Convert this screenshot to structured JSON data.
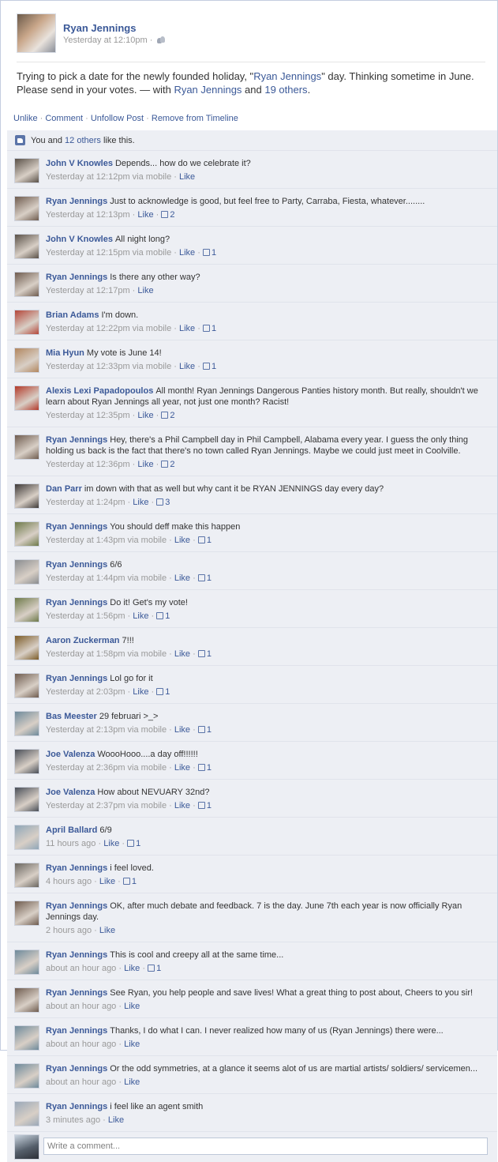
{
  "post": {
    "author": "Ryan Jennings",
    "time": "Yesterday at 12:10pm",
    "sep": "·",
    "text_part1": "Trying to pick a date for the newly founded holiday, \"",
    "text_link": "Ryan Jennings",
    "text_part2": "\" day. Thinking sometime in June. Please send in your votes. — with ",
    "with_name": "Ryan Jennings",
    "with_and": " and ",
    "with_others": "19 others",
    "with_end": "."
  },
  "actions": {
    "unlike": "Unlike",
    "comment": "Comment",
    "unfollow": "Unfollow Post",
    "remove": "Remove from Timeline",
    "sep": " · "
  },
  "likes": {
    "prefix": "You and ",
    "others": "12 others",
    "suffix": " like this."
  },
  "avatars": {
    "john": "#5a5148",
    "ryan": "#6f5c4f",
    "brian": "#b4473a",
    "mia": "#b2875f",
    "alexis": "#b33a2a",
    "dan": "#3e3a38",
    "outdoor": "#6e7a4a",
    "cap": "#8a8d90",
    "aaron": "#7c5c28",
    "bas": "#6e8a9b",
    "joe": "#4a4f58",
    "april": "#8fa6b8",
    "gym": "#6a6660",
    "agent": "#9aa8b8"
  },
  "comments": [
    {
      "name": "John V Knowles",
      "text": "Depends... how do we celebrate it?",
      "time": "Yesterday at 12:12pm",
      "via": " via mobile",
      "like": "Like",
      "count": "",
      "avatar": "john"
    },
    {
      "name": "Ryan Jennings",
      "text": "Just to acknowledge is good, but feel free to Party, Carraba, Fiesta, whatever........",
      "time": "Yesterday at 12:13pm",
      "via": "",
      "like": "Like",
      "count": "2",
      "avatar": "ryan"
    },
    {
      "name": "John V Knowles",
      "text": "All night long?",
      "time": "Yesterday at 12:15pm",
      "via": " via mobile",
      "like": "Like",
      "count": "1",
      "avatar": "john"
    },
    {
      "name": "Ryan Jennings",
      "text": "Is there any other way?",
      "time": "Yesterday at 12:17pm",
      "via": "",
      "like": "Like",
      "count": "",
      "avatar": "ryan"
    },
    {
      "name": "Brian Adams",
      "text": "I'm down.",
      "time": "Yesterday at 12:22pm",
      "via": " via mobile",
      "like": "Like",
      "count": "1",
      "avatar": "brian"
    },
    {
      "name": "Mia Hyun",
      "text": "My vote is June 14!",
      "time": "Yesterday at 12:33pm",
      "via": " via mobile",
      "like": "Like",
      "count": "1",
      "avatar": "mia"
    },
    {
      "name": "Alexis Lexi Papadopoulos",
      "text": "All month! Ryan Jennings Dangerous Panties history month. But really, shouldn't we learn about Ryan Jennings all year, not just one month? Racist!",
      "time": "Yesterday at 12:35pm",
      "via": "",
      "like": "Like",
      "count": "2",
      "avatar": "alexis"
    },
    {
      "name": "Ryan Jennings",
      "text": "Hey, there's a Phil Campbell day in Phil Campbell, Alabama every year. I guess the only thing holding us back is the fact that there's no town called Ryan Jennings. Maybe we could just meet in Coolville.",
      "time": "Yesterday at 12:36pm",
      "via": "",
      "like": "Like",
      "count": "2",
      "avatar": "ryan"
    },
    {
      "name": "Dan Parr",
      "text": "im down with that as well but why cant it be RYAN JENNINGS day every day?",
      "time": "Yesterday at 1:24pm",
      "via": "",
      "like": "Like",
      "count": "3",
      "avatar": "dan"
    },
    {
      "name": "Ryan Jennings",
      "text": "You should deff make this happen",
      "time": "Yesterday at 1:43pm",
      "via": " via mobile",
      "like": "Like",
      "count": "1",
      "avatar": "outdoor"
    },
    {
      "name": "Ryan Jennings",
      "text": "6/6",
      "time": "Yesterday at 1:44pm",
      "via": " via mobile",
      "like": "Like",
      "count": "1",
      "avatar": "cap"
    },
    {
      "name": "Ryan Jennings",
      "text": "Do it! Get's my vote!",
      "time": "Yesterday at 1:56pm",
      "via": "",
      "like": "Like",
      "count": "1",
      "avatar": "outdoor"
    },
    {
      "name": "Aaron Zuckerman",
      "text": "7!!!",
      "time": "Yesterday at 1:58pm",
      "via": " via mobile",
      "like": "Like",
      "count": "1",
      "avatar": "aaron"
    },
    {
      "name": "Ryan Jennings",
      "text": "Lol go for it",
      "time": "Yesterday at 2:03pm",
      "via": "",
      "like": "Like",
      "count": "1",
      "avatar": "ryan"
    },
    {
      "name": "Bas Meester",
      "text": "29 februari >_>",
      "time": "Yesterday at 2:13pm",
      "via": " via mobile",
      "like": "Like",
      "count": "1",
      "avatar": "bas"
    },
    {
      "name": "Joe Valenza",
      "text": "WoooHooo....a day off!!!!!!",
      "time": "Yesterday at 2:36pm",
      "via": " via mobile",
      "like": "Like",
      "count": "1",
      "avatar": "joe"
    },
    {
      "name": "Joe Valenza",
      "text": "How about NEVUARY 32nd?",
      "time": "Yesterday at 2:37pm",
      "via": " via mobile",
      "like": "Like",
      "count": "1",
      "avatar": "joe"
    },
    {
      "name": "April Ballard",
      "text": "6/9",
      "time": "11 hours ago",
      "via": "",
      "like": "Like",
      "count": "1",
      "avatar": "april"
    },
    {
      "name": "Ryan Jennings",
      "text": "i feel loved.",
      "time": "4 hours ago",
      "via": "",
      "like": "Like",
      "count": "1",
      "avatar": "gym"
    },
    {
      "name": "Ryan Jennings",
      "text": "OK, after much debate and feedback. 7 is the day. June 7th each year is now officially Ryan Jennings day.",
      "time": "2 hours ago",
      "via": "",
      "like": "Like",
      "count": "",
      "avatar": "ryan"
    },
    {
      "name": "Ryan Jennings",
      "text": "This is cool and creepy all at the same time...",
      "time": "about an hour ago",
      "via": "",
      "like": "Like",
      "count": "1",
      "avatar": "bas"
    },
    {
      "name": "Ryan Jennings",
      "text": "See Ryan, you help people and save lives! What a great thing to post about, Cheers to you sir!",
      "time": "about an hour ago",
      "via": "",
      "like": "Like",
      "count": "",
      "avatar": "ryan"
    },
    {
      "name": "Ryan Jennings",
      "text": "Thanks, I do what I can. I never realized how many of us (Ryan Jennings) there were...",
      "time": "about an hour ago",
      "via": "",
      "like": "Like",
      "count": "",
      "avatar": "bas"
    },
    {
      "name": "Ryan Jennings",
      "text": "Or the odd symmetries, at a glance it seems alot of us are martial artists/ soldiers/ servicemen...",
      "time": "about an hour ago",
      "via": "",
      "like": "Like",
      "count": "",
      "avatar": "bas"
    },
    {
      "name": "Ryan Jennings",
      "text": "i feel like an agent smith",
      "time": "3 minutes ago",
      "via": "",
      "like": "Like",
      "count": "",
      "avatar": "agent"
    }
  ],
  "composer": {
    "placeholder": "Write a comment...",
    "value": ""
  }
}
